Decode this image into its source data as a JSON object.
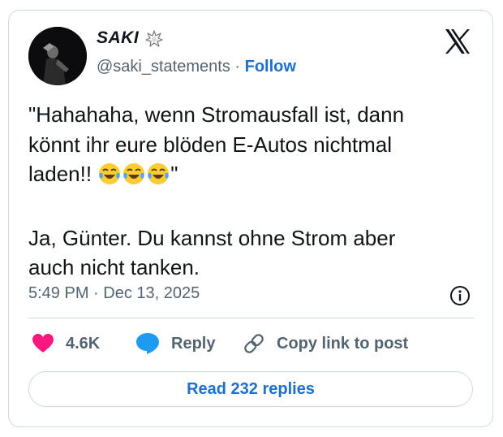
{
  "author": {
    "display_name": "SAKI",
    "handle": "@saki_statements",
    "separator": "·",
    "follow_label": "Follow"
  },
  "platform_icon": "x-logo-icon",
  "tweet": {
    "lines": [
      "\"Hahahaha, wenn Stromausfall ist, dann",
      "könnt ihr eure blöden E-Autos  nichtmal",
      "laden!! ",
      "\"",
      "Ja, Günter. Du kannst ohne Strom aber",
      "auch nicht tanken."
    ],
    "emoji": [
      "face-with-tears-of-joy",
      "face-with-tears-of-joy",
      "face-with-tears-of-joy"
    ]
  },
  "meta": {
    "timestamp": "5:49 PM · Dec 13, 2025"
  },
  "actions": {
    "likes": "4.6K",
    "reply_label": "Reply",
    "copy_link_label": "Copy link to post"
  },
  "replies_button": "Read 232 replies",
  "colors": {
    "accent": "#1d6fd0",
    "like": "#f91880",
    "reply": "#1d9bf0",
    "muted": "#536471",
    "text": "#0f1419",
    "border": "#cfd9de"
  }
}
